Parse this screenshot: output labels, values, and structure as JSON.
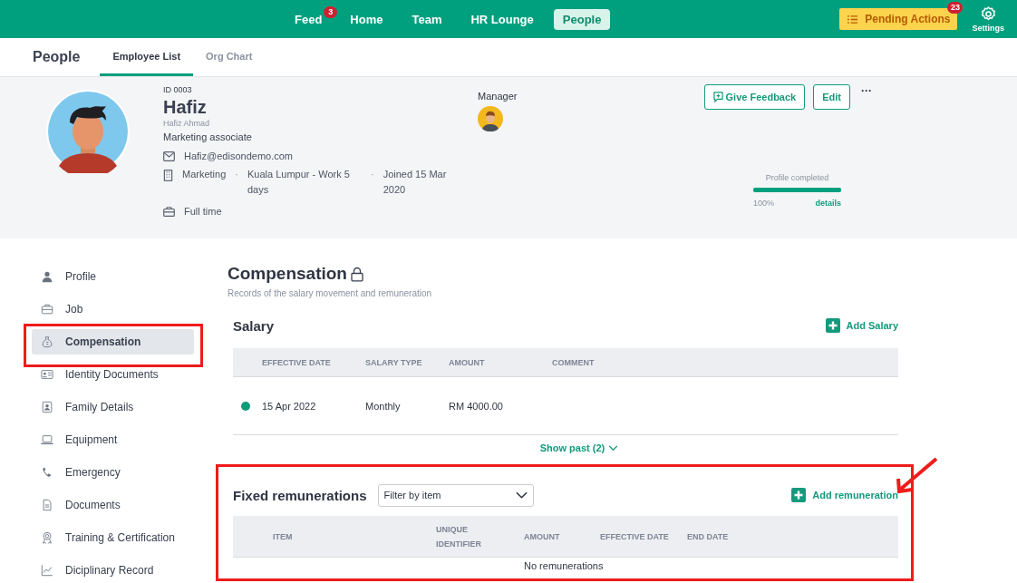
{
  "top_nav": {
    "items": [
      {
        "label": "Feed",
        "badge": "3",
        "selected": false
      },
      {
        "label": "Home",
        "selected": false
      },
      {
        "label": "Team",
        "selected": false
      },
      {
        "label": "HR Lounge",
        "selected": false
      },
      {
        "label": "People",
        "selected": true
      }
    ],
    "pending": {
      "label": "Pending Actions",
      "badge": "23"
    },
    "settings": {
      "label": "Settings"
    }
  },
  "sub_nav": {
    "title": "People",
    "tabs": [
      {
        "label": "Employee List",
        "selected": true
      },
      {
        "label": "Org Chart",
        "selected": false
      }
    ]
  },
  "employee": {
    "id": "ID 0003",
    "name": "Hafiz",
    "full_name": "Hafiz Ahmad",
    "position": "Marketing associate",
    "email": "Hafiz@edisondemo.com",
    "department": "Marketing",
    "separators": [
      "·",
      "·"
    ],
    "location": "Kuala Lumpur - Work 5 days",
    "joined": "Joined 15 Mar 2020",
    "employment": "Full time",
    "manager_label": "Manager",
    "buttons": [
      "Give Feedback",
      "Edit"
    ],
    "more": "···",
    "profile": {
      "label": "Profile completed",
      "level": 1,
      "percent": "100%",
      "link": "details"
    }
  },
  "sidebar": {
    "items": [
      {
        "label": "Profile",
        "selected": false
      },
      {
        "label": "Job",
        "selected": false
      },
      {
        "label": "Compensation",
        "selected": true
      },
      {
        "label": "Identity Documents",
        "selected": false
      },
      {
        "label": "Family Details",
        "selected": false
      },
      {
        "label": "Equipment",
        "selected": false
      },
      {
        "label": "Emergency",
        "selected": false
      },
      {
        "label": "Documents",
        "selected": false
      },
      {
        "label": "Training & Certification",
        "selected": false
      },
      {
        "label": "Diciplinary Record",
        "selected": false
      }
    ]
  },
  "compensation": {
    "title": "Compensation",
    "subtitle": "Records of the salary movement and remuneration",
    "salary": {
      "title": "Salary",
      "add": "Add Salary",
      "columns": [
        "EFFECTIVE DATE",
        "SALARY TYPE",
        "AMOUNT",
        "COMMENT"
      ],
      "rows": [
        {
          "color": "#0f9a7a",
          "cells": [
            "15 Apr 2022",
            "Monthly",
            "RM 4000.00",
            null
          ]
        }
      ],
      "show_past": "Show past (2)"
    },
    "fixed": {
      "title": "Fixed remunerations",
      "filter_placeholder": "Filter by item",
      "add": "Add remuneration",
      "columns": [
        "ITEM",
        "UNIQUE IDENTIFIER",
        "AMOUNT",
        "EFFECTIVE DATE",
        "END DATE"
      ],
      "empty": "No remunerations"
    }
  }
}
